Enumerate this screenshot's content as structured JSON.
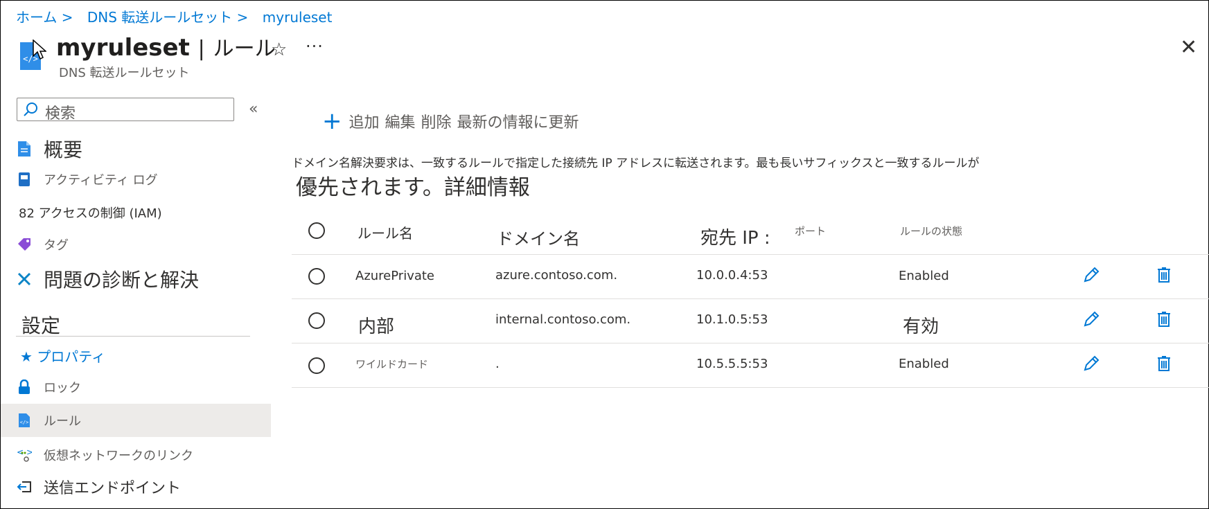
{
  "breadcrumb": {
    "items": [
      "ホーム",
      "DNS 転送ルールセット",
      "myruleset"
    ],
    "separator": ">"
  },
  "header": {
    "title": "myruleset",
    "divider": "|",
    "page": "ルール",
    "subtitle": "DNS 転送ルールセット",
    "star_icon": "☆",
    "more_icon": "···",
    "close_icon": "✕"
  },
  "sidebar": {
    "search_placeholder": "検索",
    "collapse_icon": "«",
    "items": [
      {
        "label": "概要",
        "icon": "document-icon"
      },
      {
        "label": "アクティビティ ログ",
        "icon": "activity-log-icon"
      },
      {
        "label": "82 アクセスの制御 (IAM)",
        "icon": "none"
      },
      {
        "label": "タグ",
        "icon": "tag-icon"
      },
      {
        "label": "問題の診断と解決",
        "icon": "wrench-icon"
      }
    ],
    "section_settings": "設定",
    "settings_items": [
      {
        "label": "★ プロパティ",
        "icon": "none"
      },
      {
        "label": "ロック",
        "icon": "lock-icon"
      },
      {
        "label": "ルール",
        "icon": "rules-icon",
        "selected": true
      },
      {
        "label": "仮想ネットワークのリンク",
        "icon": "network-link-icon"
      },
      {
        "label": "送信エンドポイント",
        "icon": "endpoint-icon"
      }
    ]
  },
  "toolbar": {
    "add": "追加",
    "edit": "編集",
    "delete": "削除",
    "refresh_text": "最新の情報に更新"
  },
  "description": "ドメイン名解決要求は、一致するルールで指定した接続先 IP アドレスに転送されます。最も長いサフィックスと一致するルールが",
  "more_info": "優先されます。詳細情報",
  "table": {
    "headers": {
      "rule_name": "ルール名",
      "domain": "ドメイン名",
      "dest_ip": "宛先 IP :",
      "port": "ポート",
      "state": "ルールの状態"
    },
    "rows": [
      {
        "name": "AzurePrivate",
        "domain": "azure.contoso.com.",
        "ip": "10.0.0.4:53",
        "state": "Enabled"
      },
      {
        "name": "内部",
        "domain": "internal.contoso.com.",
        "ip": "10.1.0.5:53",
        "state": "有効"
      },
      {
        "name": "ワイルドカード",
        "domain": ".",
        "ip": "10.5.5.5:53",
        "state": "Enabled"
      }
    ]
  },
  "colors": {
    "accent": "#0078d4",
    "selected_bg": "#edebe9",
    "text": "#323130"
  }
}
